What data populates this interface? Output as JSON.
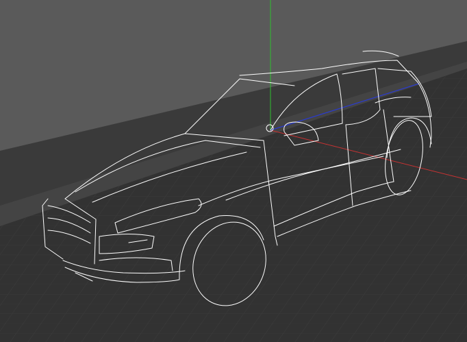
{
  "viewport": {
    "kind": "3d-wireframe-viewport",
    "model": "suv-wireframe",
    "colors": {
      "background": "#5a5a5a",
      "ground": "#323232",
      "ground_grid": "#3d3d3d",
      "back_wall": "#3a3a3a",
      "wall_top": "#444444",
      "wireframe": "#ffffff",
      "axis_x": "#c83232",
      "axis_y": "#2fbf2f",
      "axis_z": "#2a3bd1"
    }
  }
}
